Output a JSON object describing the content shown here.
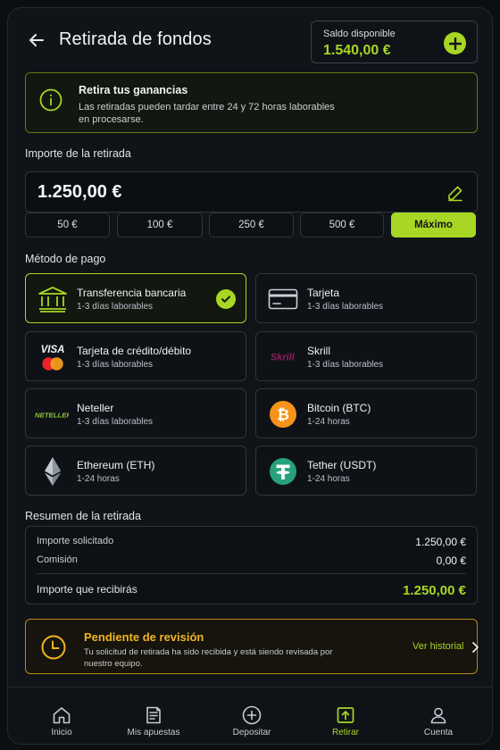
{
  "header": {
    "title": "Retirada de fondos",
    "balance_label": "Saldo disponible",
    "balance_amount": "1.540,00 €"
  },
  "info": {
    "title": "Retira tus ganancias",
    "description": "Las retiradas pueden tardar entre 24 y 72 horas laborables en procesarse."
  },
  "amount": {
    "label": "Importe de la retirada",
    "value": "1.250,00 €",
    "quick_options": [
      "50 €",
      "100 €",
      "250 €",
      "500 €",
      "Máximo"
    ],
    "selected_quick": "Máximo"
  },
  "payment": {
    "label": "Método de pago",
    "selected": "Transferencia bancaria",
    "methods": [
      {
        "name": "Transferencia bancaria",
        "time": "1-3 días laborables",
        "icon": "bank-icon"
      },
      {
        "name": "Tarjeta",
        "time": "1-3 días laborables",
        "icon": "card-icon"
      },
      {
        "name": "Tarjeta de crédito/débito",
        "time": "1-3 días laborables",
        "icon": "visa-mastercard-icon",
        "logo_text": "VISA"
      },
      {
        "name": "Skrill",
        "time": "1-3 días laborables",
        "icon": "skrill-logo-icon",
        "logo_text": "Skrill"
      },
      {
        "name": "Neteller",
        "time": "1-3 días laborables",
        "icon": "neteller-logo-icon",
        "logo_text": "NETELLER"
      },
      {
        "name": "Bitcoin (BTC)",
        "time": "1-24 horas",
        "icon": "bitcoin-icon"
      },
      {
        "name": "Ethereum (ETH)",
        "time": "1-24 horas",
        "icon": "ethereum-icon"
      },
      {
        "name": "Tether (USDT)",
        "time": "1-24 horas",
        "icon": "tether-icon"
      }
    ]
  },
  "summary": {
    "label": "Resumen de la retirada",
    "requested_label": "Importe solicitado",
    "requested_value": "1.250,00 €",
    "fee_label": "Comisión",
    "fee_value": "0,00 €",
    "receive_label": "Importe que recibirás",
    "receive_value": "1.250,00 €"
  },
  "pending": {
    "title": "Pendiente de revisión",
    "description": "Tu solicitud de retirada ha sido recibida y está siendo revisada por nuestro equipo.",
    "link": "Ver historial"
  },
  "nav": {
    "active": "Retirar",
    "items": [
      {
        "label": "Inicio",
        "icon": "home-icon"
      },
      {
        "label": "Mis apuestas",
        "icon": "bets-icon"
      },
      {
        "label": "Depositar",
        "icon": "plus-circle-icon"
      },
      {
        "label": "Retirar",
        "icon": "withdraw-icon"
      },
      {
        "label": "Cuenta",
        "icon": "user-icon"
      }
    ]
  },
  "colors": {
    "accent": "#a8d624",
    "warning": "#f0b425",
    "background": "#101418"
  }
}
